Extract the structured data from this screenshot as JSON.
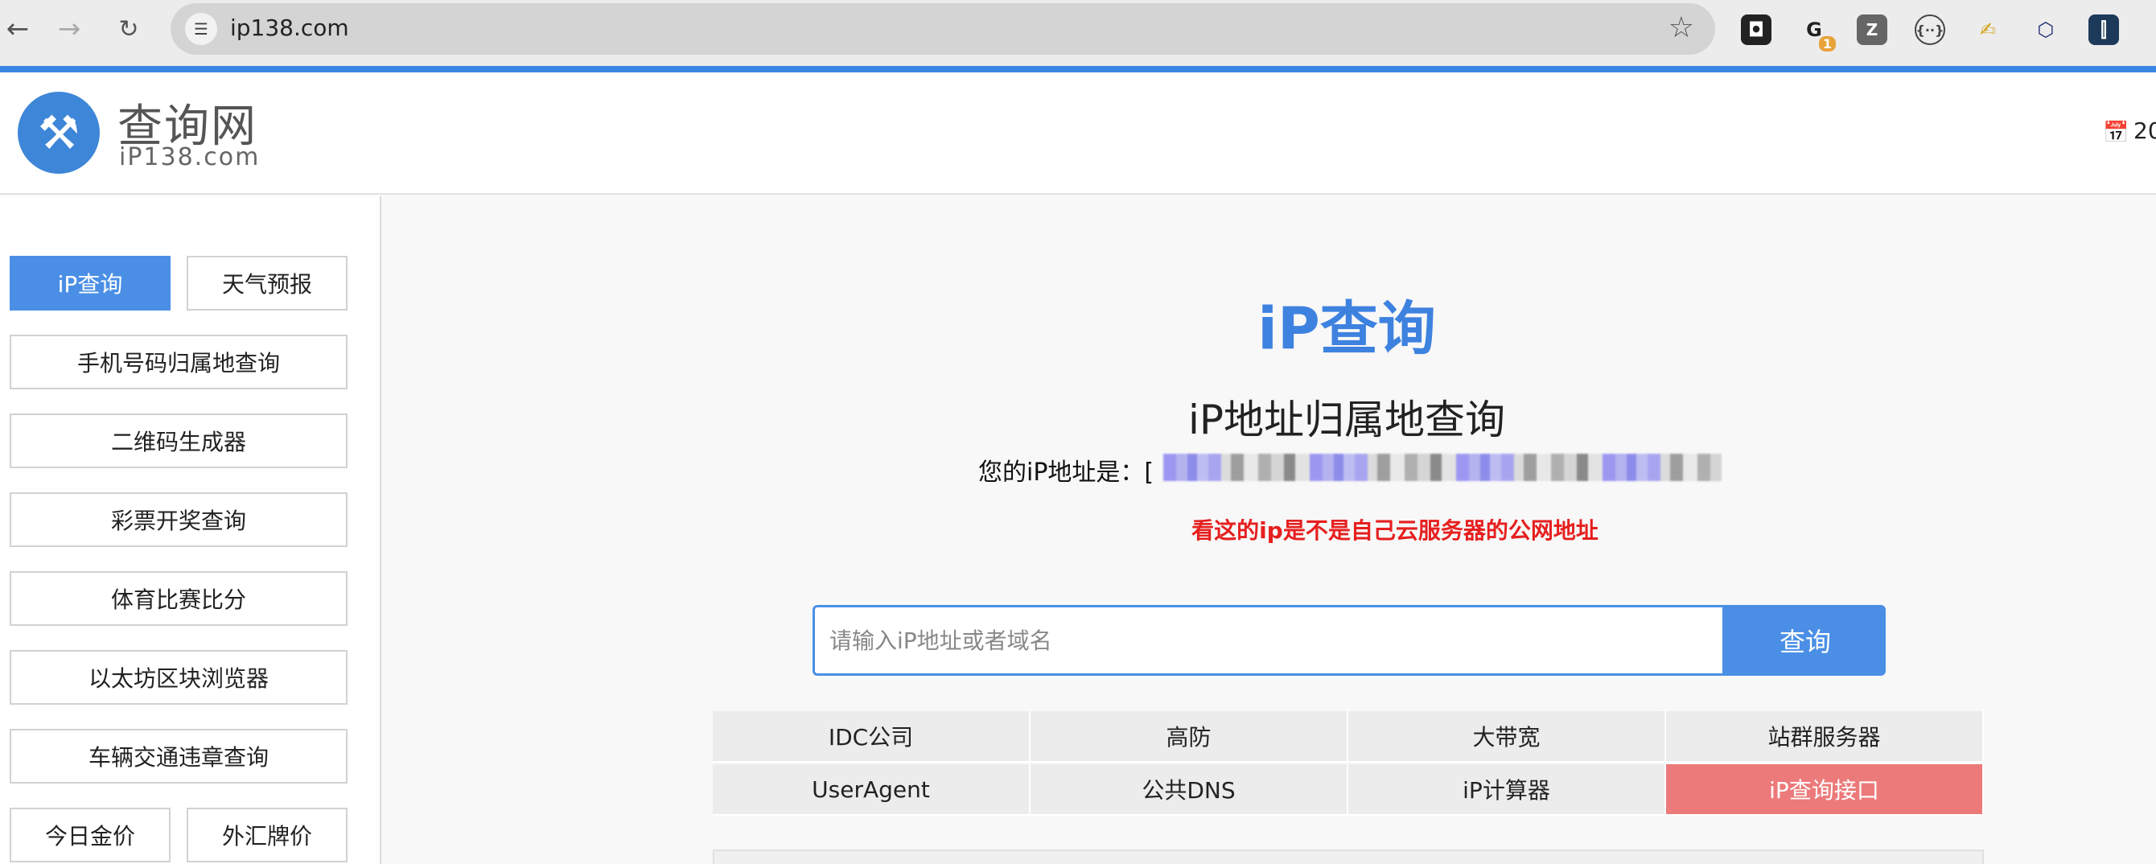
{
  "browser": {
    "url": "ip138.com",
    "back_icon": "arrow-left",
    "forward_icon": "arrow-right",
    "reload_icon": "reload",
    "extensions": [
      {
        "name": "extension-icon-1",
        "glyph": "◘"
      },
      {
        "name": "extension-icon-2",
        "glyph": "G",
        "badge": "1"
      },
      {
        "name": "extension-icon-3",
        "glyph": "Z"
      },
      {
        "name": "extension-icon-4",
        "glyph": "{··}"
      },
      {
        "name": "extension-icon-5",
        "glyph": "✍"
      },
      {
        "name": "extension-icon-6",
        "glyph": "⬡"
      },
      {
        "name": "extension-icon-7",
        "glyph": "⫿"
      }
    ]
  },
  "header": {
    "logo_cn": "查询网",
    "logo_en": "iP138.com",
    "date_partial": "20"
  },
  "sidebar": {
    "items": [
      {
        "label": "iP查询",
        "active": true
      },
      {
        "label": "天气预报"
      },
      {
        "label": "手机号码归属地查询"
      },
      {
        "label": "二维码生成器"
      },
      {
        "label": "彩票开奖查询"
      },
      {
        "label": "体育比赛比分"
      },
      {
        "label": "以太坊区块浏览器"
      },
      {
        "label": "车辆交通违章查询"
      },
      {
        "label": "今日金价"
      },
      {
        "label": "外汇牌价"
      }
    ]
  },
  "main": {
    "title": "iP查询",
    "subtitle": "iP地址归属地查询",
    "ip_label": "您的iP地址是：[",
    "annotation": "看这的ip是不是自己云服务器的公网地址",
    "search_placeholder": "请输入iP地址或者域名",
    "search_button": "查询",
    "links": [
      "IDC公司",
      "高防",
      "大带宽",
      "站群服务器",
      "UserAgent",
      "公共DNS",
      "iP计算器",
      "iP查询接口"
    ]
  },
  "colors": {
    "accent": "#4a8fe5",
    "title_blue": "#3e82e0",
    "warning_red": "#e61f1f",
    "hot_link": "#ec7a7a"
  }
}
